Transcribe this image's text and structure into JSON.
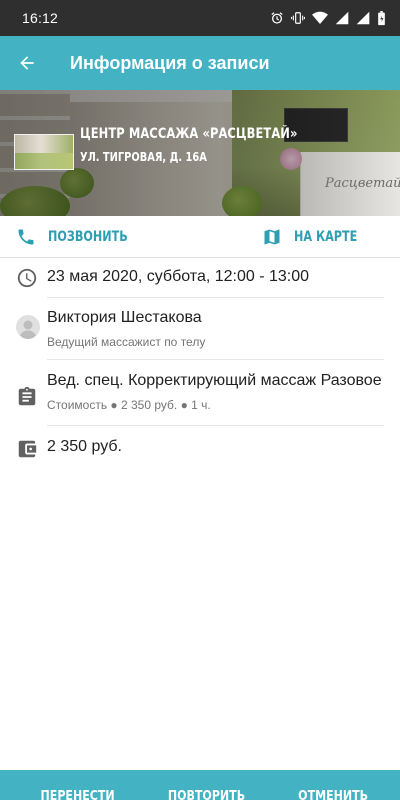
{
  "status_bar": {
    "time": "16:12",
    "icons": [
      "alarm-icon",
      "vibrate-icon",
      "wifi-icon",
      "signal-icon",
      "signal-2-icon",
      "battery-icon"
    ]
  },
  "app_bar": {
    "title": "Информация о записи",
    "back_icon": "arrow-back-icon",
    "color": "#43b3c4"
  },
  "venue": {
    "name": "Центр массажа «Расцветай»",
    "address": "ул. Тигровая, д. 16А",
    "sign_text": "Расцветай"
  },
  "actions": {
    "call_label": "Позвонить",
    "map_label": "На карте",
    "accent_color": "#2e9fb2"
  },
  "appointment": {
    "datetime": "23 мая 2020, суббота, 12:00 - 13:00",
    "master_name": "Виктория Шестакова",
    "master_title": "Ведущий массажист по телу",
    "service_name": "Вед. спец. Корректирующий массаж Разовое",
    "service_details": "Стоимость ● 2 350 руб. ● 1 ч.",
    "price": "2 350 руб."
  },
  "bottom_bar": {
    "reschedule_label": "Перенести",
    "repeat_label": "Повторить",
    "cancel_label": "Отменить"
  }
}
